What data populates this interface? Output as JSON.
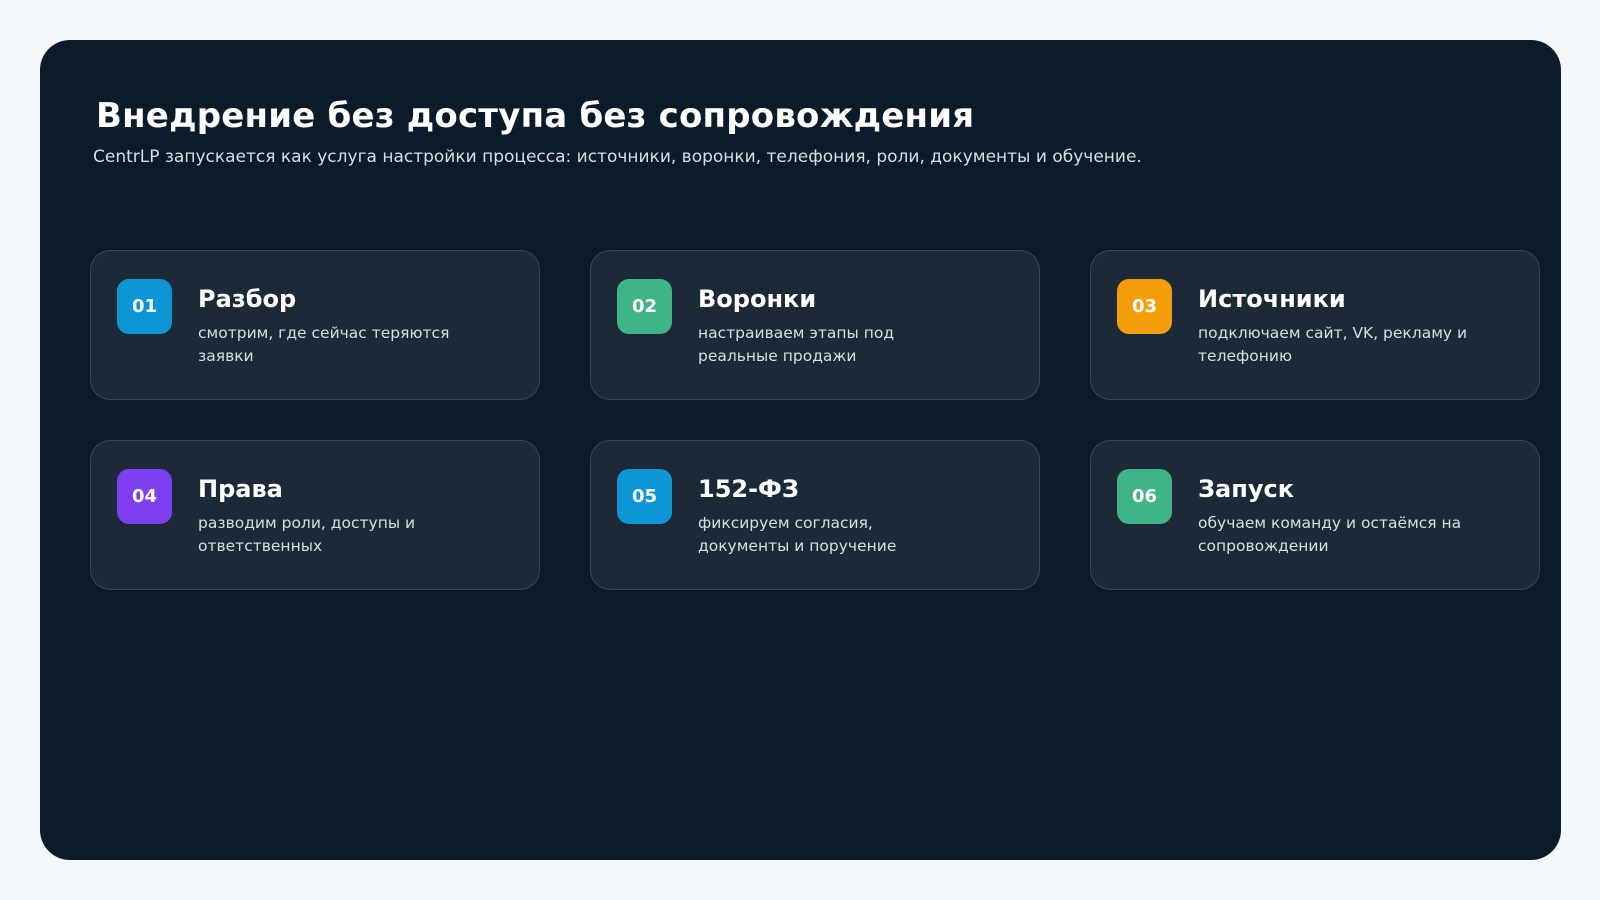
{
  "header": {
    "title": "Внедрение без доступа без сопровождения",
    "subtitle": "CentrLP запускается как услуга настройки процесса: источники, воронки, телефония, роли, документы и обучение."
  },
  "steps": [
    {
      "number": "01",
      "title": "Разбор",
      "description": "смотрим, где сейчас теряются заявки",
      "color": "#0e95d6"
    },
    {
      "number": "02",
      "title": "Воронки",
      "description": "настраиваем этапы под реальные продажи",
      "color": "#3fb488"
    },
    {
      "number": "03",
      "title": "Источники",
      "description": "подключаем сайт, VK, рекламу и телефонию",
      "color": "#f49e0b"
    },
    {
      "number": "04",
      "title": "Права",
      "description": "разводим роли, доступы и ответственных",
      "color": "#7c3ff0"
    },
    {
      "number": "05",
      "title": "152-ФЗ",
      "description": "фиксируем согласия, документы и поручение",
      "color": "#0e95d6"
    },
    {
      "number": "06",
      "title": "Запуск",
      "description": "обучаем команду и остаёмся на сопровождении",
      "color": "#3fb488"
    }
  ]
}
